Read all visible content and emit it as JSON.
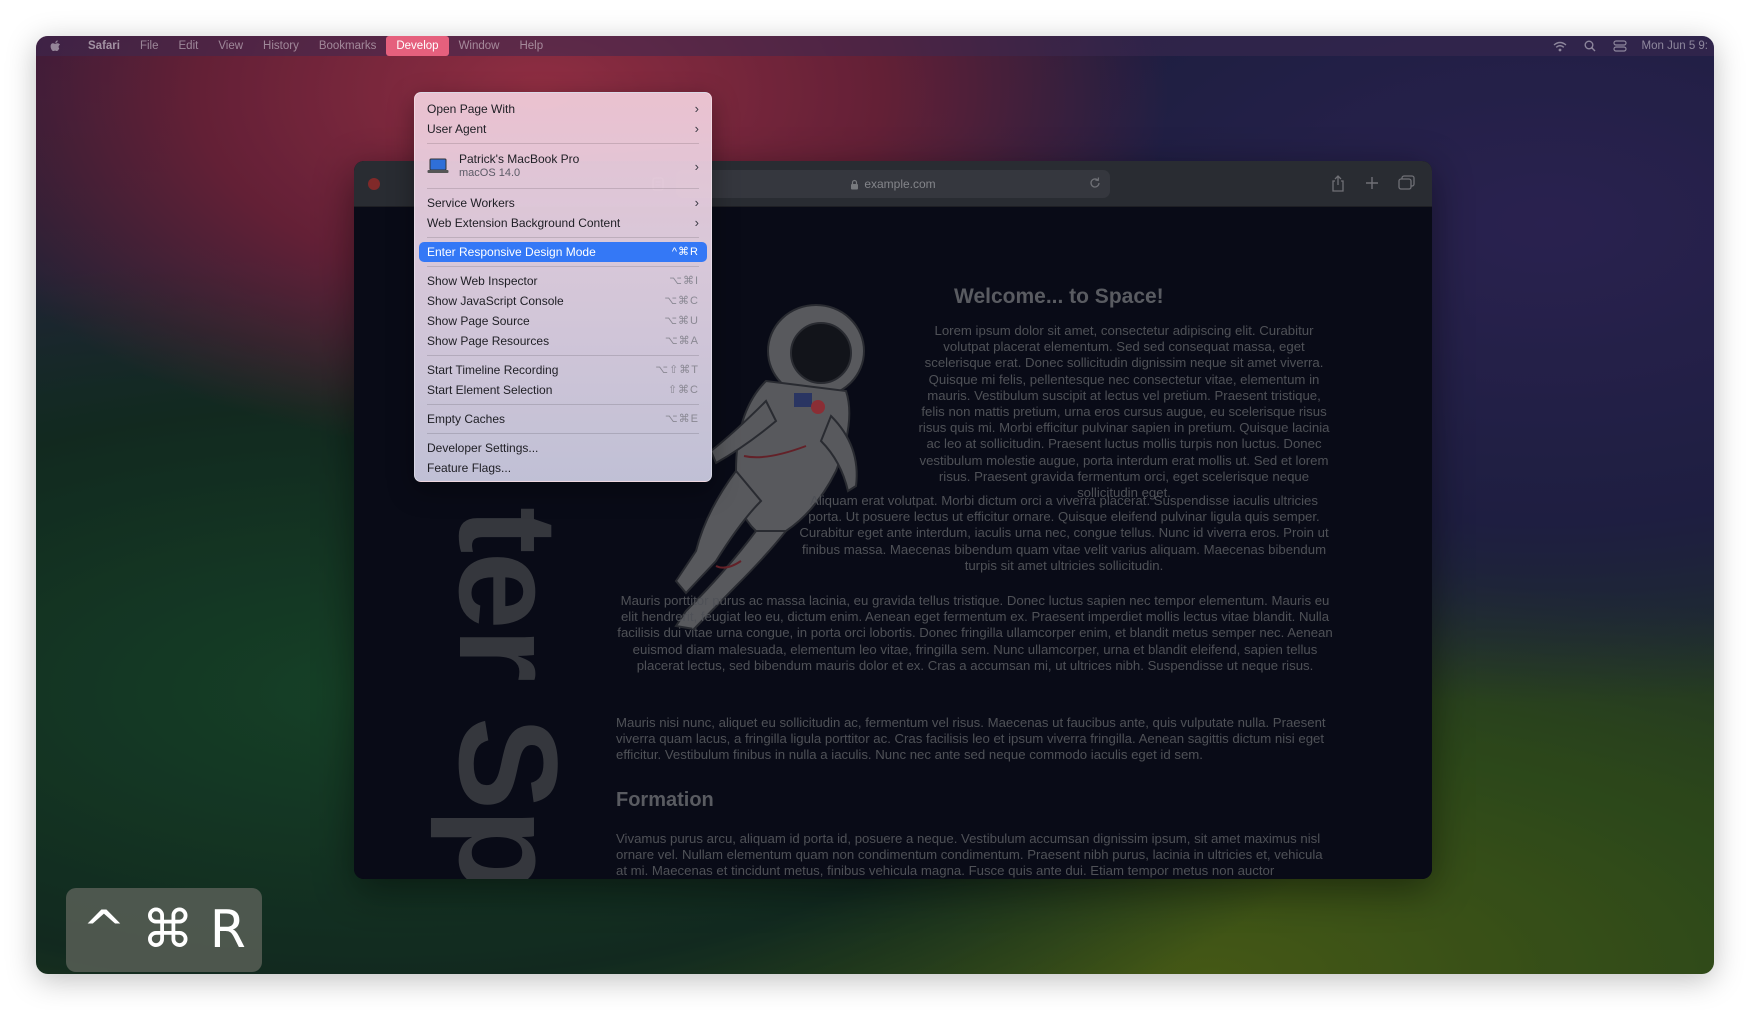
{
  "menubar": {
    "app": "Safari",
    "items": [
      "File",
      "Edit",
      "View",
      "History",
      "Bookmarks",
      "Develop",
      "Window",
      "Help"
    ],
    "clock": "Mon Jun 5  9:"
  },
  "browser": {
    "url": "example.com"
  },
  "page": {
    "vertical_text": "ter Spa",
    "heading": "Welcome... to Space!",
    "p1": "Lorem ipsum dolor sit amet, consectetur adipiscing elit. Curabitur volutpat placerat elementum. Sed sed consequat massa, eget scelerisque erat. Donec sollicitudin dignissim neque sit amet viverra. Quisque mi felis, pellentesque nec consectetur vitae, elementum in mauris. Vestibulum suscipit at lectus vel pretium. Praesent tristique, felis non mattis pretium, urna eros cursus augue, eu scelerisque risus risus quis mi. Morbi efficitur pulvinar sapien in pretium. Quisque lacinia ac leo at sollicitudin. Praesent luctus mollis turpis non luctus. Donec vestibulum molestie augue, porta interdum erat mollis ut. Sed et lorem risus. Praesent gravida fermentum orci, eget scelerisque neque sollicitudin eget.",
    "p2": "Aliquam erat volutpat. Morbi dictum orci a viverra placerat. Suspendisse iaculis ultricies porta. Ut posuere lectus ut efficitur ornare. Quisque eleifend pulvinar ligula quis semper. Curabitur eget ante interdum, iaculis urna nec, congue tellus. Nunc id viverra eros. Proin ut finibus massa. Maecenas bibendum quam vitae velit varius aliquam. Maecenas bibendum turpis sit amet ultricies sollicitudin.",
    "p3": "Mauris porttitor purus ac massa lacinia, eu gravida tellus tristique. Donec luctus sapien nec tempor elementum. Mauris eu elit hendrerit, feugiat leo eu, dictum enim. Aenean eget fermentum ex. Praesent imperdiet mollis lectus vitae blandit. Nulla facilisis dui vitae urna congue, in porta orci lobortis. Donec fringilla ullamcorper enim, et blandit metus semper nec. Aenean euismod diam malesuada, elementum leo vitae, fringilla sem. Nunc ullamcorper, urna et blandit eleifend, sapien tellus placerat lectus, sed bibendum mauris dolor et ex. Cras a accumsan mi, ut ultrices nibh. Suspendisse ut neque risus.",
    "p4": "Mauris nisi nunc, aliquet eu sollicitudin ac, fermentum vel risus. Maecenas ut faucibus ante, quis vulputate nulla. Praesent viverra quam lacus, a fringilla ligula porttitor ac. Cras facilisis leo et ipsum viverra fringilla. Aenean sagittis dictum nisi eget efficitur. Vestibulum finibus in nulla a iaculis. Nunc nec ante sed neque commodo iaculis eget id sem.",
    "subheading": "Formation",
    "p5": "Vivamus purus arcu, aliquam id porta id, posuere a neque. Vestibulum accumsan dignissim ipsum, sit amet maximus nisl ornare vel. Nullam elementum quam non condimentum condimentum. Praesent nibh purus, lacinia in ultricies et, vehicula at mi. Maecenas et tincidunt metus, finibus vehicula magna. Fusce quis ante dui. Etiam tempor metus non auctor"
  },
  "develop_menu": {
    "open_page_with": "Open Page With",
    "user_agent": "User Agent",
    "device_name": "Patrick's MacBook Pro",
    "device_os": "macOS 14.0",
    "service_workers": "Service Workers",
    "web_ext_bg": "Web Extension Background Content",
    "responsive": {
      "label": "Enter Responsive Design Mode",
      "shortcut": "^⌘R"
    },
    "inspector": {
      "label": "Show Web Inspector",
      "shortcut": "⌥⌘I"
    },
    "js_console": {
      "label": "Show JavaScript Console",
      "shortcut": "⌥⌘C"
    },
    "page_source": {
      "label": "Show Page Source",
      "shortcut": "⌥⌘U"
    },
    "page_resources": {
      "label": "Show Page Resources",
      "shortcut": "⌥⌘A"
    },
    "timeline": {
      "label": "Start Timeline Recording",
      "shortcut": "⌥⇧⌘T"
    },
    "element_sel": {
      "label": "Start Element Selection",
      "shortcut": "⇧⌘C"
    },
    "empty_caches": {
      "label": "Empty Caches",
      "shortcut": "⌥⌘E"
    },
    "dev_settings": "Developer Settings...",
    "feature_flags": "Feature Flags..."
  },
  "shortcut_overlay": {
    "ctrl": "^",
    "cmd": "⌘",
    "key": "R"
  },
  "colors": {
    "highlight": "#3478f6",
    "develop_active": "#e5607d"
  },
  "icons": [
    "apple-icon",
    "wifi-icon",
    "search-icon",
    "control-center-icon",
    "lock-icon",
    "reload-icon",
    "reader-icon",
    "share-icon",
    "new-tab-icon",
    "tabs-overview-icon",
    "laptop-icon",
    "chevron-right-icon"
  ]
}
